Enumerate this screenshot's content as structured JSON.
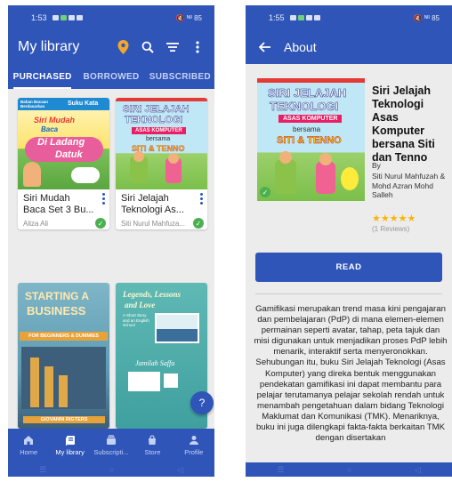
{
  "left": {
    "status_time": "1:53",
    "status_right": "🔇 ᴺᴵˡ 85",
    "title": "My library",
    "tabs": [
      {
        "label": "PURCHASED",
        "active": true
      },
      {
        "label": "BORROWED",
        "active": false
      },
      {
        "label": "SUBSCRIBED",
        "active": false
      }
    ],
    "books": [
      {
        "title": "Siri Mudah Baca Set 3 Bu...",
        "author": "Aliza Ali",
        "cover_lines": [
          "Bahan Bacaan Berdasarkan",
          "Suku Kata",
          "Siri Mudah",
          "Baca",
          "Di Ladang",
          "Datuk"
        ],
        "downloaded": true
      },
      {
        "title": "Siri Jelajah Teknologi As...",
        "author": "Siti Nurul Mahfuza...",
        "cover_lines": [
          "SIRI JELAJAH",
          "TEKNOLOGI",
          "ASAS KOMPUTER",
          "bersama",
          "SITI & TENNO"
        ],
        "downloaded": true
      },
      {
        "title": "",
        "author": "",
        "cover_lines": [
          "STARTING A",
          "BUSINESS",
          "FOR BEGINNERS & DUMMIES",
          "GIOVANNI RIGTERS"
        ],
        "downloaded": false
      },
      {
        "title": "",
        "author": "",
        "cover_lines": [
          "Legends, Lessons",
          "and Love",
          "A Short Story and an English School",
          "Jamilah Saffa"
        ],
        "downloaded": false
      }
    ],
    "bottom_nav": [
      {
        "label": "Home",
        "icon": "home-icon",
        "active": false
      },
      {
        "label": "My library",
        "icon": "library-icon",
        "active": true
      },
      {
        "label": "Subscripti...",
        "icon": "subscription-icon",
        "active": false
      },
      {
        "label": "Store",
        "icon": "store-icon",
        "active": false
      },
      {
        "label": "Profile",
        "icon": "profile-icon",
        "active": false
      }
    ],
    "fab_icon": "help-icon"
  },
  "right": {
    "status_time": "1:55",
    "status_right": "🔇 ᴺᴵˡ 85",
    "title": "About",
    "book": {
      "title": "Siri Jelajah Teknologi Asas Komputer bersana Siti dan Tenno",
      "by": "By",
      "author": "Siti Nurul Mahfuzah & Mohd Azran Mohd Salleh",
      "rating": "★★★★★",
      "reviews": "(1 Reviews)",
      "read_label": "READ",
      "cover_lines": [
        "SIRI JELAJAH",
        "TEKNOLOGI",
        "ASAS KOMPUTER",
        "bersama",
        "SITI & TENNO"
      ],
      "description": "Gamifikasi merupakan trend masa kini pengajaran dan pembelajaran (PdP) di mana elemen-elemen permainan seperti avatar, tahap, peta tajuk dan misi digunakan untuk menjadikan proses PdP lebih menarik, interaktif serta menyeronokkan. Sehubungan itu, buku Siri Jelajah Teknologi (Asas Komputer) yang direka bentuk menggunakan pendekatan gamifikasi ini dapat membantu para pelajar terutamanya pelajar sekolah rendah untuk menambah pengetahuan dalam bidang Teknologi Maklumat dan Komunikasi (TMK). Menariknya, buku ini juga dilengkapi fakta-fakta berkaitan TMK dengan disertakan"
    }
  },
  "colors": {
    "primary": "#2f55b8",
    "accent_pin": "#f4a62a",
    "check": "#4caf50",
    "star": "#ffb300"
  }
}
